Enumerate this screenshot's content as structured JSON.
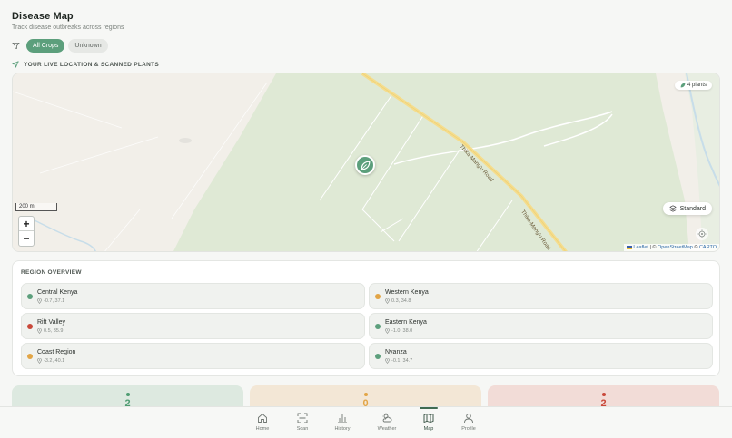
{
  "header": {
    "title": "Disease Map",
    "subtitle": "Track disease outbreaks across regions"
  },
  "filters": {
    "icon": "filter-icon",
    "chips": [
      {
        "label": "All Crops",
        "active": true
      },
      {
        "label": "Unknown",
        "active": false
      }
    ]
  },
  "live_section": {
    "icon": "navigation-arrow-icon",
    "label": "YOUR LIVE LOCATION & SCANNED PLANTS"
  },
  "map": {
    "plants_badge": "4 plants",
    "layer_button": "Standard",
    "scale": "200 m",
    "zoom_in": "+",
    "zoom_out": "−",
    "road_label_1": "Thika-Mang'u Road",
    "road_label_2": "Thika-Mang'u Road",
    "attribution_leaflet": "Leaflet",
    "attribution_sep": " | © ",
    "attribution_osm": "OpenStreetMap",
    "attribution_carto_prefix": " © ",
    "attribution_carto": "CARTO",
    "colors": {
      "land": "#f2efe9",
      "park": "#dfe9d5",
      "road": "#f5dd8d",
      "water": "#c7dde9"
    }
  },
  "regions": {
    "title": "REGION OVERVIEW",
    "items": [
      {
        "name": "Central Kenya",
        "coords": "-0.7, 37.1",
        "color": "#5c9f7c"
      },
      {
        "name": "Western Kenya",
        "coords": "0.3, 34.8",
        "color": "#e2a546"
      },
      {
        "name": "Rift Valley",
        "coords": "0.5, 35.9",
        "color": "#c9483a"
      },
      {
        "name": "Eastern Kenya",
        "coords": "-1.0, 38.0",
        "color": "#5c9f7c"
      },
      {
        "name": "Coast Region",
        "coords": "-3.2, 40.1",
        "color": "#e2a546"
      },
      {
        "name": "Nyanza",
        "coords": "-0.1, 34.7",
        "color": "#5c9f7c"
      }
    ]
  },
  "stats": [
    {
      "value": "2",
      "color": "#4f9c72",
      "bg": "#dde9e0"
    },
    {
      "value": "0",
      "color": "#e2a546",
      "bg": "#f3e7d6"
    },
    {
      "value": "2",
      "color": "#c9483a",
      "bg": "#f2dcd7"
    }
  ],
  "nav": {
    "items": [
      {
        "label": "Home",
        "icon": "home-icon"
      },
      {
        "label": "Scan",
        "icon": "scan-icon"
      },
      {
        "label": "History",
        "icon": "bar-chart-icon"
      },
      {
        "label": "Weather",
        "icon": "weather-icon"
      },
      {
        "label": "Map",
        "icon": "map-icon",
        "active": true
      },
      {
        "label": "Profile",
        "icon": "user-icon"
      }
    ]
  }
}
